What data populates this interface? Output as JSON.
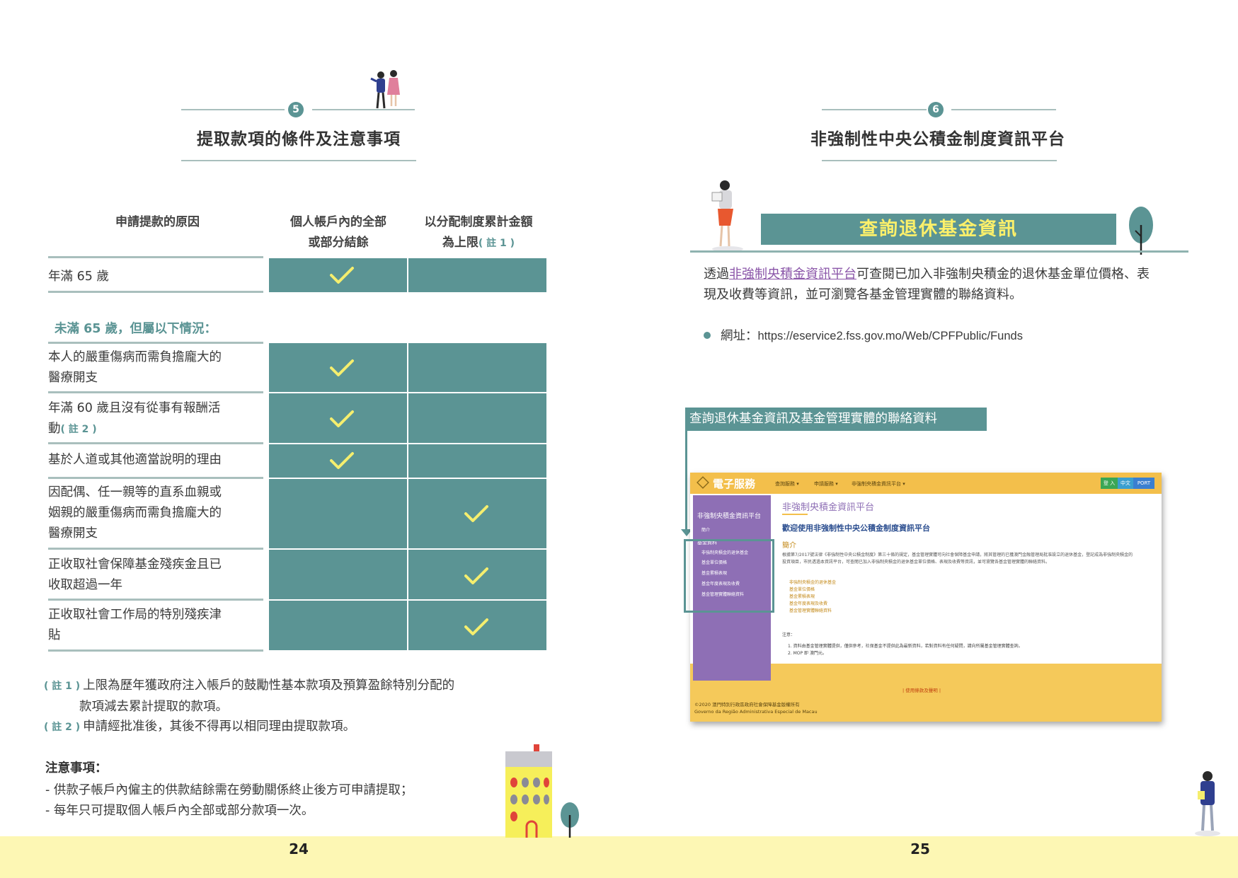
{
  "left_page": {
    "section_number": "5",
    "section_title": "提取款項的條件及注意事項",
    "table": {
      "col_reason": "申請提款的原因",
      "col_full_1": "個人帳戶內的全部",
      "col_full_2": "或部分結餘",
      "col_limit_1": "以分配制度累計金額",
      "col_limit_2": "為上限",
      "col_limit_note": "( 註 1 )",
      "row_65": "年滿 65 歲",
      "under65_heading": "未滿 65 歲，但屬以下情況：",
      "rows": [
        {
          "l1": "本人的嚴重傷病而需負擔龐大的",
          "l2": "醫療開支",
          "l3": "",
          "note": "",
          "full": true,
          "limit": false
        },
        {
          "l1": "年滿 60 歲且沒有從事有報酬活",
          "l2": "動",
          "l3": "",
          "note": "( 註 2 )",
          "full": true,
          "limit": false
        },
        {
          "l1": "基於人道或其他適當說明的理由",
          "l2": "",
          "l3": "",
          "note": "",
          "full": true,
          "limit": false
        },
        {
          "l1": "因配偶、任一親等的直系血親或",
          "l2": "姻親的嚴重傷病而需負擔龐大的",
          "l3": "醫療開支",
          "note": "",
          "full": false,
          "limit": true
        },
        {
          "l1": "正收取社會保障基金殘疾金且已",
          "l2": "收取超過一年",
          "l3": "",
          "note": "",
          "full": false,
          "limit": true
        },
        {
          "l1": "正收取社會工作局的特別殘疾津",
          "l2": "貼",
          "l3": "",
          "note": "",
          "full": false,
          "limit": true
        }
      ]
    },
    "footnotes": {
      "n1_tag": "( 註 1 )",
      "n1_l1": "上限為歷年獲政府注入帳戶的鼓勵性基本款項及預算盈餘特別分配的",
      "n1_l2": "款項減去累計提取的款項。",
      "n2_tag": "( 註 2 )",
      "n2_text": "申請經批准後，其後不得再以相同理由提取款項。"
    },
    "notice": {
      "title": "注意事項：",
      "items": [
        "-   供款子帳戶內僱主的供款結餘需在勞動關係終止後方可申請提取；",
        "-   每年只可提取個人帳戶內全部或部分款項一次。"
      ]
    },
    "page_number": "24"
  },
  "right_page": {
    "section_number": "6",
    "section_title": "非強制性中央公積金制度資訊平台",
    "banner": "查詢退休基金資訊",
    "intro_pre": "透過",
    "intro_link": "非強制央積金資訊平台",
    "intro_post_1": "可查閱已加入非強制央積金的退休基金單位價格、表",
    "intro_post_2": "現及收費等資訊，並可瀏覽各基金管理實體的聯絡資料。",
    "url_label": "網址：",
    "url": "https://eservice2.fss.gov.mo/Web/CPFPublic/Funds",
    "callout": "查詢退休基金資訊及基金管理實體的聯絡資料",
    "screenshot": {
      "brand": "電子服務",
      "menu": [
        "查詢服務 ▾",
        "申請服務 ▾",
        "非強制央積金資訊平台 ▾"
      ],
      "btn_login": "登 入",
      "btn_lang": "中文",
      "btn_port": "PORT",
      "side_title": "非強制央積金資訊平台",
      "side_intro": "簡介",
      "side_fund": "基金資料",
      "side_items": [
        "非強制央積金的退休基金",
        "基金單位價格",
        "基金累積表現",
        "基金年度表現及收費",
        "基金管理實體聯絡資料"
      ],
      "title": "非強制央積金資訊平台",
      "welcome": "歡迎使用非強制性中央公積金制度資訊平台",
      "intro_h": "簡介",
      "para": "根據第7/2017號法律《非強制性中央公積金制度》第三十條的規定，基金管理實體可向社會保障基金申請，將其管理的已獲澳門金融管理局批准設立的退休基金，登記成為非強制央積金的投資項目，市民透過本資訊平台，可查閱已加入非強制央積金的退休基金單位價格、表現及收費等資訊，並可瀏覽各基金管理實體的聯絡資料。",
      "list": [
        "非強制央積金的退休基金",
        "基金單位價格",
        "基金累積表現",
        "基金年度表現及收費",
        "基金管理實體聯絡資料"
      ],
      "note_h": "注意：",
      "notes": [
        "1. 資料由基金管理實體提供，僅供參考，社保基金不提供此為最新資料，若對資料有任何疑問，請向所屬基金管理實體查詢。",
        "2. MOP 即 澳門元。"
      ],
      "foot_link": "| 使用條款及聲明 |",
      "foot_1": "©2020 澳門特別行政區政府社會保障基金版權所有",
      "foot_2": "Governo da Região Administrativa Especial de Macau"
    },
    "page_number": "25"
  },
  "colors": {
    "teal": "#5b9494",
    "band": "#fdf7b4",
    "check": "#f5ee6e",
    "purple": "#8e6fb5"
  }
}
